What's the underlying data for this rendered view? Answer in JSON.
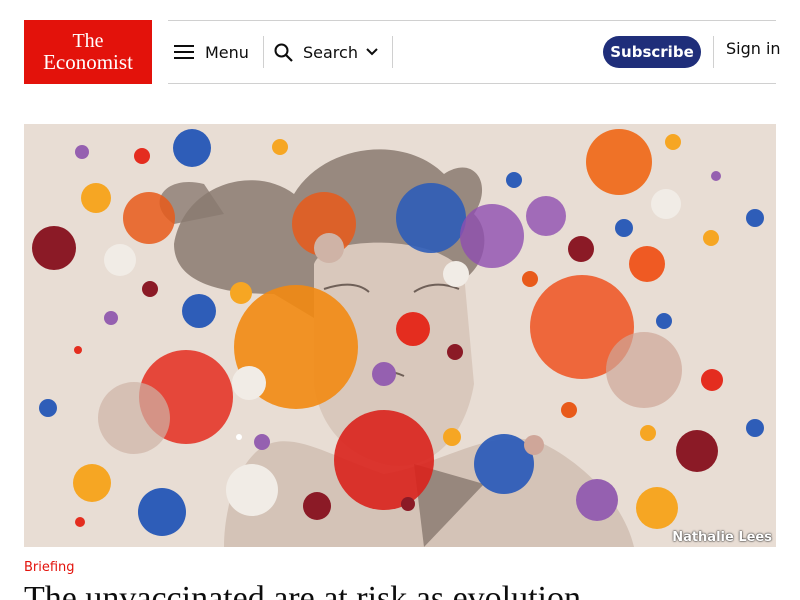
{
  "header": {
    "logo": {
      "line1": "The",
      "line2": "Economist"
    },
    "menu_label": "Menu",
    "search_label": "Search",
    "subscribe_label": "Subscribe",
    "signin_label": "Sign in"
  },
  "hero": {
    "credit": "Nathalie Lees"
  },
  "article": {
    "section": "Briefing",
    "headline": "The unvaccinated are at risk as evolution"
  },
  "colors": {
    "brand_red": "#e3120b",
    "subscribe_blue": "#1f2e7a",
    "hero_background": "#e8ddd4"
  }
}
